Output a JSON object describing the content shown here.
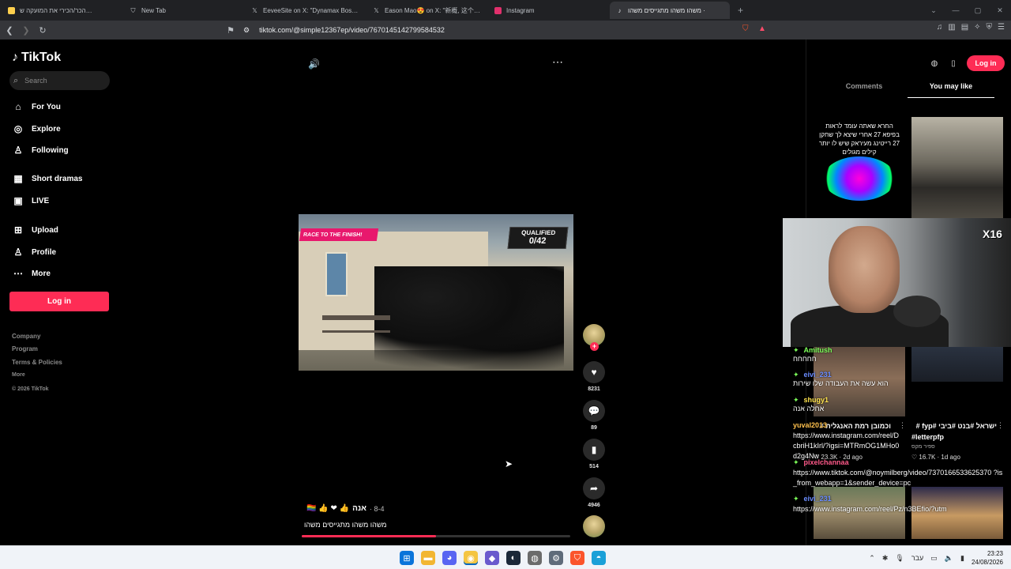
{
  "browser": {
    "tabs": [
      {
        "title": "הכר/הכירי את המועקה ש…",
        "icon": "globe-icon",
        "color": "#ffd04d",
        "active": false
      },
      {
        "title": "New Tab",
        "icon": "brave-icon",
        "color": "#9aa0a6",
        "active": false
      },
      {
        "title": "EeveeSite on X: \"Dynamax Boss batt…",
        "icon": "x-icon",
        "color": "#ffffff",
        "active": false
      },
      {
        "title": "Eason Mao😍 on X: \"新概, 这个一…",
        "icon": "x-icon",
        "color": "#ffffff",
        "active": false
      },
      {
        "title": "Instagram",
        "icon": "instagram-icon",
        "color": "#e1306c",
        "active": false
      },
      {
        "title": "משהו משהו מתגייסים משהו ·",
        "icon": "tiktok-icon",
        "color": "#ffffff",
        "active": true
      }
    ],
    "url": "tiktok.com/@simple12367ep/video/7670145142799584532"
  },
  "sidebar": {
    "logo": "TikTok",
    "search_placeholder": "Search",
    "nav": [
      {
        "label": "For You",
        "icon": "home-icon",
        "glyph": "⌂"
      },
      {
        "label": "Explore",
        "icon": "compass-icon",
        "glyph": "◎"
      },
      {
        "label": "Following",
        "icon": "person-icon",
        "glyph": "♙"
      },
      {
        "label": "Short dramas",
        "icon": "film-icon",
        "glyph": "▦"
      },
      {
        "label": "LIVE",
        "icon": "tv-icon",
        "glyph": "▣"
      },
      {
        "label": "Upload",
        "icon": "plus-box-icon",
        "glyph": "⊞"
      },
      {
        "label": "Profile",
        "icon": "profile-icon",
        "glyph": "♙"
      },
      {
        "label": "More",
        "icon": "more-icon",
        "glyph": "⋯"
      }
    ],
    "login": "Log in",
    "footer": [
      "Company",
      "Program",
      "Terms & Policies",
      "More"
    ],
    "copyright": "© 2026 TikTok"
  },
  "video": {
    "banner": "RACE TO THE FINISH!",
    "qualified_label": "QUALIFIED",
    "qualified_count": "0/42",
    "author_name": "אנה",
    "author_emoji": "🏳‍🌈 👍 ❤ 👍",
    "date": "8-4",
    "caption": "משהו משהו מתגייסים משהו",
    "likes": "8231",
    "comments": "89",
    "saves": "514",
    "shares": "4946",
    "progress": 0.5
  },
  "right_panel": {
    "login": "Log in",
    "tabs": [
      "Comments",
      "You may like"
    ],
    "thumb1_text": "החרא שאתה עומד לראות בפיפא 27 אחרי שיצא לך שחקן 27 רייטינג מעיראק שיש לו יותר קילים מגולים",
    "item1": {
      "title": "וכמובן רמת האנגלית #",
      "user": "",
      "likes": "23.3K",
      "age": "2d ago"
    },
    "item2": {
      "title": "ישראל #בנט #ביבי #fyp #",
      "title2": "#letterpfp",
      "user": "ספיר מקס",
      "likes": "16.7K",
      "age": "1d ago"
    },
    "x16": "X16"
  },
  "chat": [
    {
      "name": "Amitush",
      "text": "חחחחח"
    },
    {
      "name": "eivi_231",
      "text": "הוא עשה את העבודה שלו שירות"
    },
    {
      "name": "shugy1",
      "text": "אחלה אנה"
    },
    {
      "name": "yuval2013",
      "text": "https://www.instagram.com/reel/DcbriH1kIrl/?igsi=MTRmOG1MHo0d2g4Nw"
    },
    {
      "name": "pixelchannaa",
      "text": "https://www.tiktok.com/@noymilberg/video/7370166533625370\n?is_from_webapp=1&sender_device=pc"
    },
    {
      "name": "eivi_231",
      "text": "https://www.instagram.com/reel/Pz/n3BEfio/?utm"
    }
  ],
  "taskbar": {
    "time": "23:23",
    "date": "24/08/2026",
    "lang": "עבר"
  }
}
